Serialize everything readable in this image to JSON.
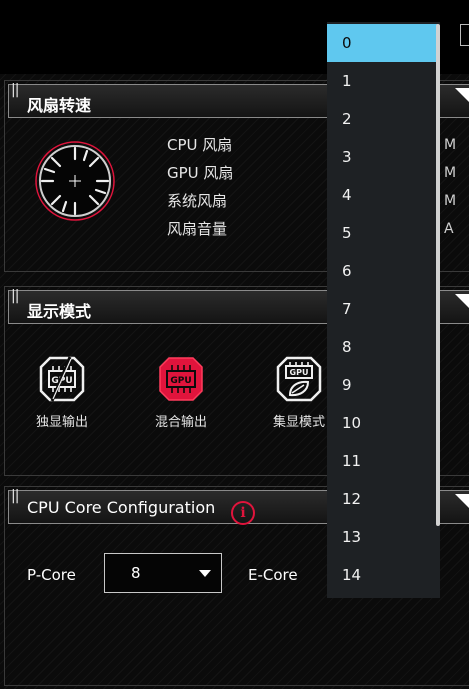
{
  "fan_section": {
    "title": "风扇转速",
    "labels": [
      "CPU 风扇",
      "GPU 风扇",
      "系统风扇",
      "风扇音量"
    ],
    "tail_glyphs": [
      "M",
      "M",
      "M",
      "A"
    ]
  },
  "display_section": {
    "title": "显示模式",
    "modes": [
      {
        "label": "独显输出",
        "icon_text": "GPU",
        "active": false
      },
      {
        "label": "混合输出",
        "icon_text": "GPU",
        "active": true
      },
      {
        "label": "集显模式",
        "icon_text": "GPU",
        "active": false
      }
    ]
  },
  "cpu_section": {
    "title": "CPU Core Configuration",
    "info_glyph": "i",
    "pcore_label": "P-Core",
    "pcore_value": "8",
    "ecore_label": "E-Core"
  },
  "dropdown": {
    "selected_index": 0,
    "options": [
      "0",
      "1",
      "2",
      "3",
      "4",
      "5",
      "6",
      "7",
      "8",
      "9",
      "10",
      "11",
      "12",
      "13",
      "14"
    ]
  },
  "colors": {
    "accent": "#e0143c",
    "selection": "#5fc8ef"
  }
}
